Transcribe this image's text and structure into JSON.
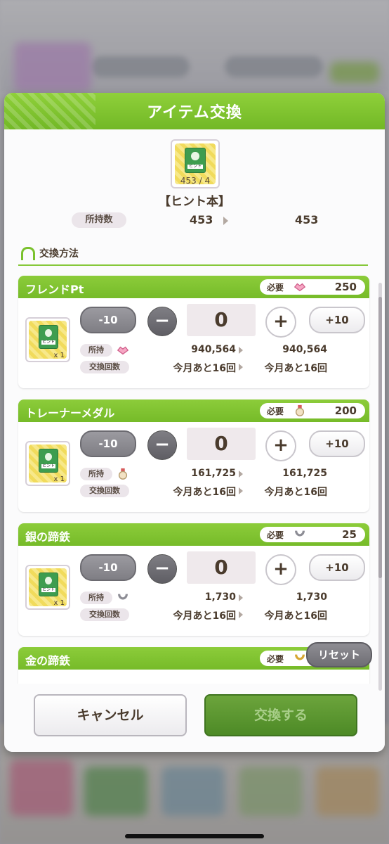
{
  "dialog": {
    "title": "アイテム交換",
    "item_name": "【ヒント本】",
    "item_count_label": "453 / 4",
    "owned_label": "所持数",
    "owned_before": "453",
    "owned_after": "453",
    "section_title": "交換方法",
    "book_tag": "ヒント"
  },
  "cards": [
    {
      "name": "フレンドPt",
      "required_label": "必要",
      "required_value": "250",
      "required_icon": "friend-pt-icon",
      "qty": "0",
      "minus10": "-10",
      "plus10": "+10",
      "minus": "−",
      "plus": "+",
      "item_qty": "x 1",
      "owned_label": "所持",
      "owned_before": "940,564",
      "owned_after": "940,564",
      "count_label": "交換回数",
      "count_before": "今月あと16回",
      "count_after": "今月あと16回"
    },
    {
      "name": "トレーナーメダル",
      "required_label": "必要",
      "required_value": "200",
      "required_icon": "trainer-medal-icon",
      "qty": "0",
      "minus10": "-10",
      "plus10": "+10",
      "minus": "−",
      "plus": "+",
      "item_qty": "x 1",
      "owned_label": "所持",
      "owned_before": "161,725",
      "owned_after": "161,725",
      "count_label": "交換回数",
      "count_before": "今月あと16回",
      "count_after": "今月あと16回"
    },
    {
      "name": "銀の蹄鉄",
      "required_label": "必要",
      "required_value": "25",
      "required_icon": "silver-horseshoe-icon",
      "qty": "0",
      "minus10": "-10",
      "plus10": "+10",
      "minus": "−",
      "plus": "+",
      "item_qty": "x 1",
      "owned_label": "所持",
      "owned_before": "1,730",
      "owned_after": "1,730",
      "count_label": "交換回数",
      "count_before": "今月あと16回",
      "count_after": "今月あと16回"
    },
    {
      "name": "金の蹄鉄",
      "required_label": "必要",
      "required_icon": "gold-horseshoe-icon"
    }
  ],
  "buttons": {
    "reset": "リセット",
    "cancel": "キャンセル",
    "exchange": "交換する"
  },
  "colors": {
    "accent_green": "#7cc12e",
    "header_green": "#76bb29",
    "text_brown": "#4a3b2d"
  }
}
